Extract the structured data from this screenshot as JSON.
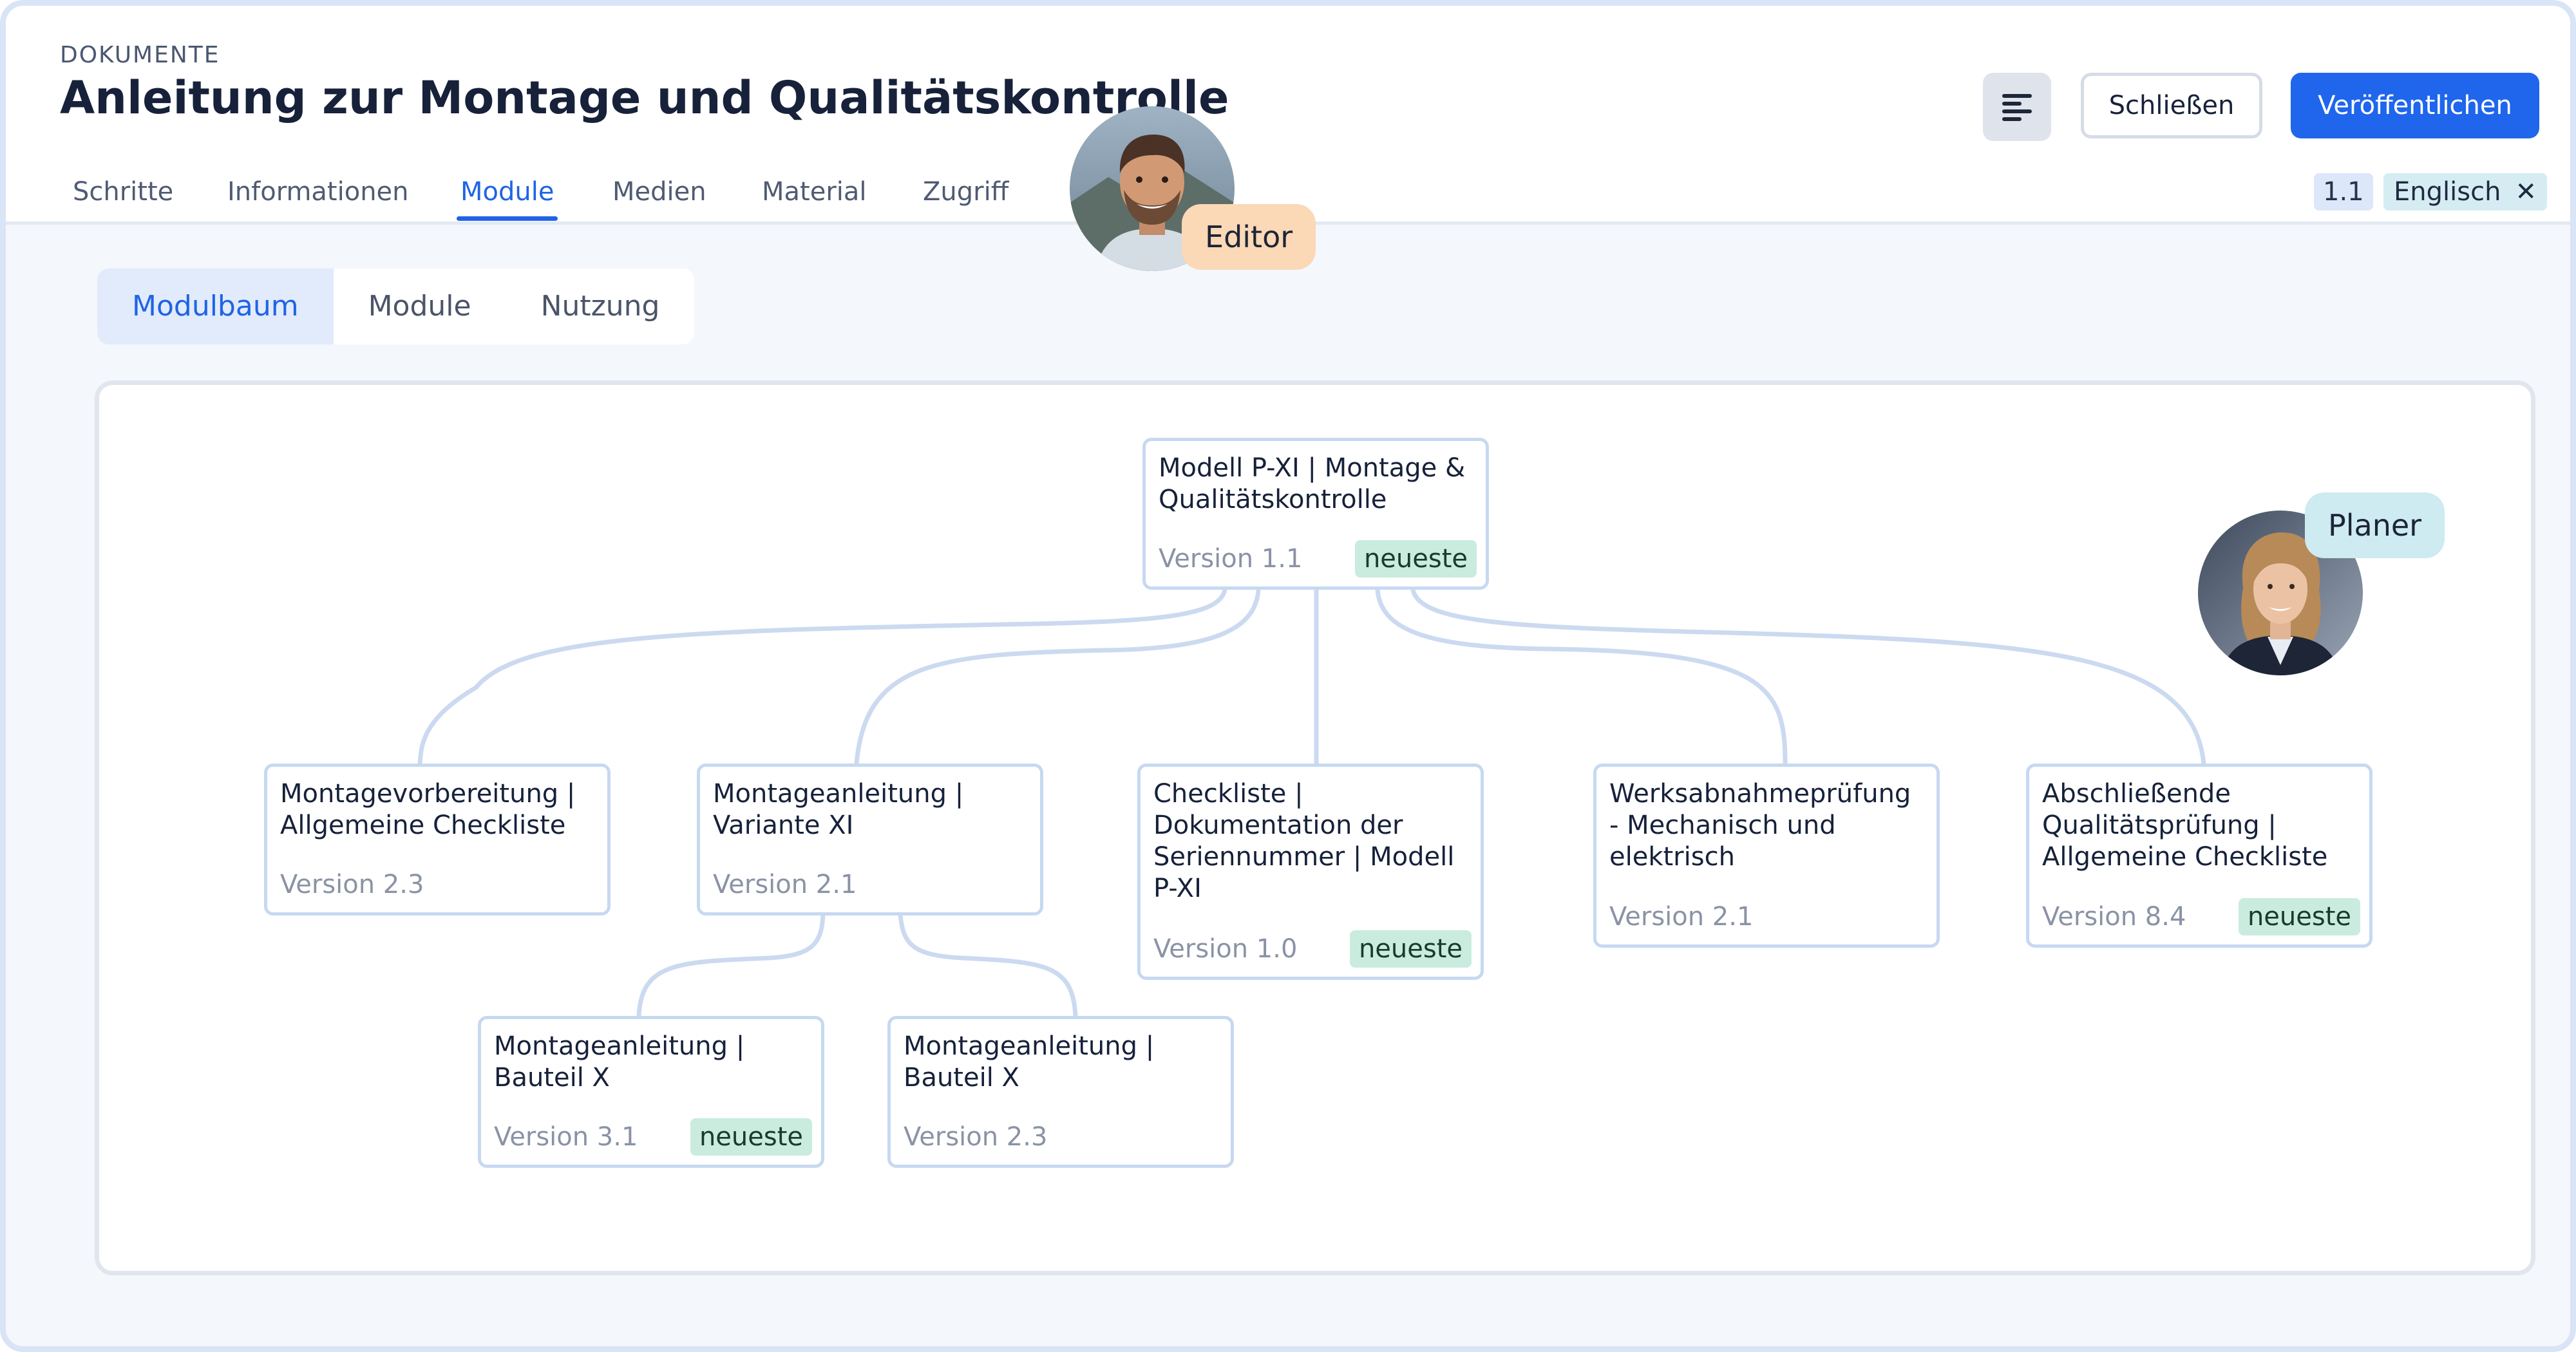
{
  "header": {
    "breadcrumb": "DOKUMENTE",
    "title": "Anleitung zur Montage und Qualitätskontrolle",
    "tabs": [
      {
        "label": "Schritte"
      },
      {
        "label": "Informationen"
      },
      {
        "label": "Module"
      },
      {
        "label": "Medien"
      },
      {
        "label": "Material"
      },
      {
        "label": "Zugriff"
      }
    ],
    "active_tab": "Module",
    "buttons": {
      "menu_icon": "text-align-left-icon",
      "close_label": "Schließen",
      "publish_label": "Veröffentlichen"
    },
    "version_chip": "1.1",
    "language_chip": "Englisch",
    "language_remove_icon": "close-icon"
  },
  "collaborators": {
    "editor": {
      "role_label": "Editor"
    },
    "planer": {
      "role_label": "Planer"
    }
  },
  "subtabs": [
    {
      "label": "Modulbaum"
    },
    {
      "label": "Module"
    },
    {
      "label": "Nutzung"
    }
  ],
  "active_subtab": "Modulbaum",
  "tree": {
    "root": {
      "title": "Modell P-XI | Montage & Qualitätskontrolle",
      "version": "Version 1.1",
      "badge": "neueste"
    },
    "children": [
      {
        "title": "Montagevorbereitung | Allgemeine Checkliste",
        "version": "Version 2.3",
        "badge": ""
      },
      {
        "title": "Montageanleitung | Variante XI",
        "version": "Version 2.1",
        "badge": ""
      },
      {
        "title": "Checkliste | Dokumentation der Seriennummer | Modell P-XI",
        "version": "Version 1.0",
        "badge": "neueste"
      },
      {
        "title": "Werksabnahmeprüfung - Mechanisch und elektrisch",
        "version": "Version 2.1",
        "badge": ""
      },
      {
        "title": "Abschließende Qualitätsprüfung | Allgemeine Checkliste",
        "version": "Version 8.4",
        "badge": "neueste"
      }
    ],
    "grandchildren": [
      {
        "title": "Montageanleitung | Bauteil X",
        "version": "Version 3.1",
        "badge": "neueste"
      },
      {
        "title": "Montageanleitung | Bauteil X",
        "version": "Version 2.3",
        "badge": ""
      }
    ]
  },
  "colors": {
    "accent": "#1f66ec",
    "badge_green": "#c9ecdf",
    "node_border": "#c7d8f1",
    "editor_badge": "#fbd8b6",
    "planer_badge": "#cdebf1"
  }
}
